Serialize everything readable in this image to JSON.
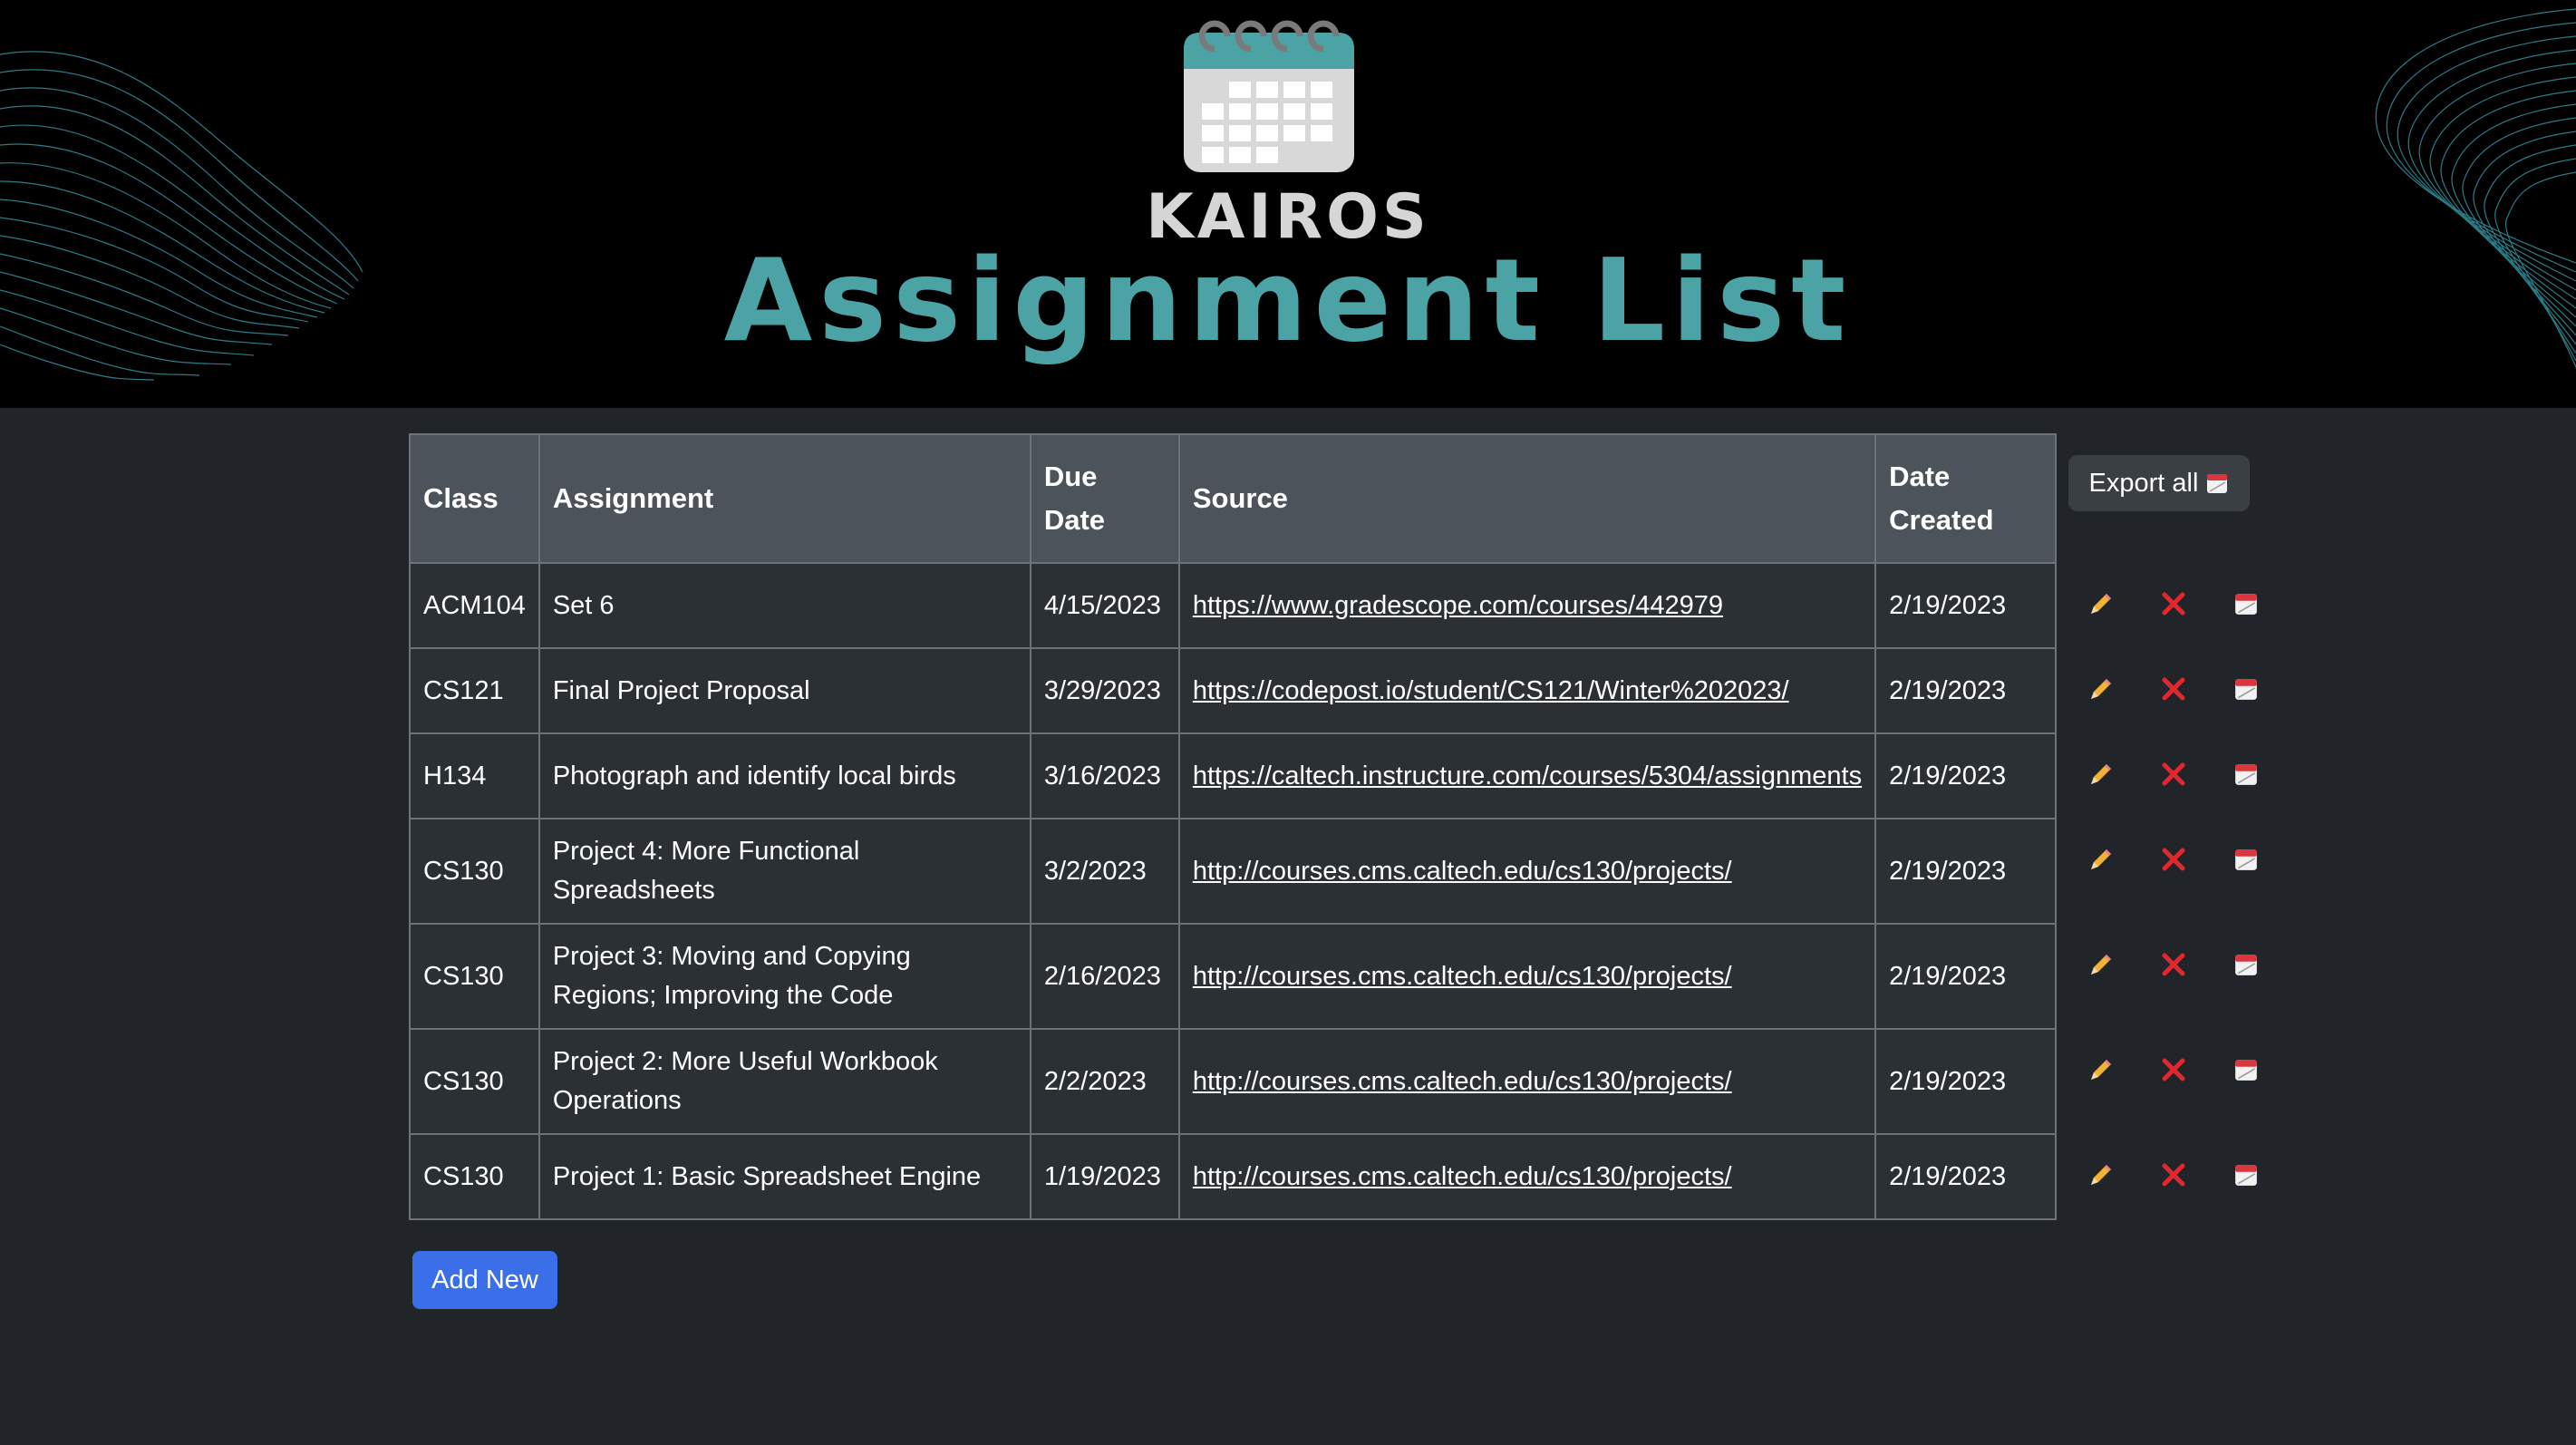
{
  "header": {
    "brand": "KAIROS",
    "title": "Assignment List",
    "accent_color": "#4ba3a6",
    "logo_icon": "calendar-icon"
  },
  "table": {
    "headers": {
      "class": "Class",
      "assignment": "Assignment",
      "due_date": "Due Date",
      "source": "Source",
      "date_created": "Date Created"
    },
    "rows": [
      {
        "class": "ACM104",
        "assignment": "Set 6",
        "due_date": "4/15/2023",
        "source": "https://www.gradescope.com/courses/442979",
        "date_created": "2/19/2023"
      },
      {
        "class": "CS121",
        "assignment": "Final Project Proposal",
        "due_date": "3/29/2023",
        "source": "https://codepost.io/student/CS121/Winter%202023/",
        "date_created": "2/19/2023"
      },
      {
        "class": "H134",
        "assignment": "Photograph and identify local birds",
        "due_date": "3/16/2023",
        "source": "https://caltech.instructure.com/courses/5304/assignments",
        "date_created": "2/19/2023"
      },
      {
        "class": "CS130",
        "assignment": "Project 4: More Functional Spreadsheets",
        "due_date": "3/2/2023",
        "source": "http://courses.cms.caltech.edu/cs130/projects/",
        "date_created": "2/19/2023"
      },
      {
        "class": "CS130",
        "assignment": "Project 3: Moving and Copying Regions; Improving the Code",
        "due_date": "2/16/2023",
        "source": "http://courses.cms.caltech.edu/cs130/projects/",
        "date_created": "2/19/2023"
      },
      {
        "class": "CS130",
        "assignment": "Project 2: More Useful Workbook Operations",
        "due_date": "2/2/2023",
        "source": "http://courses.cms.caltech.edu/cs130/projects/",
        "date_created": "2/19/2023"
      },
      {
        "class": "CS130",
        "assignment": "Project 1: Basic Spreadsheet Engine",
        "due_date": "1/19/2023",
        "source": "http://courses.cms.caltech.edu/cs130/projects/",
        "date_created": "2/19/2023"
      }
    ]
  },
  "actions": {
    "export_all_label": "Export all",
    "export_icon": "calendar-icon",
    "row_icons": [
      "pencil-icon",
      "delete-x-icon",
      "calendar-icon"
    ],
    "add_new_label": "Add New",
    "add_button_color": "#3b6fe9",
    "delete_color": "#e0282e"
  }
}
